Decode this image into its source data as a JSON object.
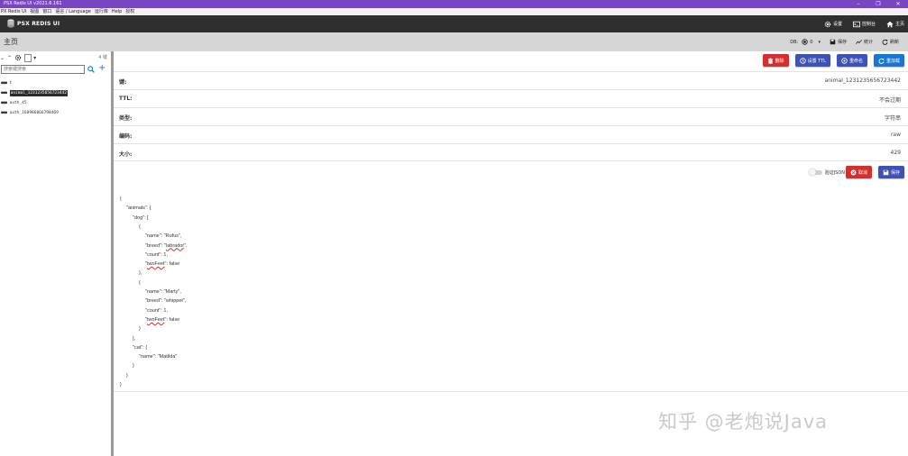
{
  "window": {
    "title": "PSX Redis UI v2021.6.161",
    "controls": [
      "–",
      "❐",
      "✕"
    ]
  },
  "menu": [
    "PX Redis UI",
    "视图",
    "窗口",
    "语言 / Language",
    "运行库",
    "Help",
    "授权"
  ],
  "appbar": {
    "brand": "PSX REDIS UI",
    "nav": [
      {
        "label": "设置",
        "icon": "gear-icon"
      },
      {
        "label": "控制台",
        "icon": "console-icon"
      },
      {
        "label": "主页",
        "icon": "home-icon"
      }
    ]
  },
  "page": {
    "title": "主页",
    "db_label": "DB:",
    "db_value": "0",
    "db_caret": "▾",
    "save_label": "保存",
    "stats_label": "统计",
    "refresh_label": "刷新"
  },
  "sidebar": {
    "tools": [
      "⌄",
      "⌃"
    ],
    "count": "4 键",
    "search_placeholder": "搜索键搜索",
    "plus": "+",
    "dots": "●●●",
    "keys": [
      {
        "name": "t",
        "active": false
      },
      {
        "name": "animal_1231235656723442",
        "active": true
      },
      {
        "name": "auth_45",
        "active": false
      },
      {
        "name": "auth_168986866798469",
        "active": false
      }
    ]
  },
  "key_actions": {
    "delete": "删除",
    "ttl": "设置 TTL",
    "rename": "重命名",
    "reload": "重加载"
  },
  "details": [
    {
      "label": "键:",
      "value": "animal_1231235656723442"
    },
    {
      "label": "TTL:",
      "value": "不会过期"
    },
    {
      "label": "类型:",
      "value": "字符串"
    },
    {
      "label": "编码:",
      "value": "raw"
    },
    {
      "label": "大小:",
      "value": "429"
    }
  ],
  "editor_bar": {
    "validate_json": "验证JSON",
    "cancel": "取消",
    "save": "保存"
  },
  "json_lines": [
    {
      "indent": 0,
      "text": "{"
    },
    {
      "indent": 1,
      "text": "\"animals\": {"
    },
    {
      "indent": 2,
      "text": "\"dog\": ["
    },
    {
      "indent": 3,
      "text": "{"
    },
    {
      "indent": 4,
      "text": "\"name\": \"Rufus\","
    },
    {
      "indent": 4,
      "text": "\"breed\": \"labrador\","
    },
    {
      "indent": 4,
      "text": "\"count\": 1,"
    },
    {
      "indent": 4,
      "text": "\"twoFeet\": false"
    },
    {
      "indent": 3,
      "text": "},"
    },
    {
      "indent": 3,
      "text": "{"
    },
    {
      "indent": 4,
      "text": "\"name\": \"Marty\","
    },
    {
      "indent": 4,
      "text": "\"breed\": \"whippet\","
    },
    {
      "indent": 4,
      "text": "\"count\": 1,"
    },
    {
      "indent": 4,
      "text": "\"twoFeet\": false"
    },
    {
      "indent": 3,
      "text": "}"
    },
    {
      "indent": 2,
      "text": "],"
    },
    {
      "indent": 2,
      "text": "\"cat\": {"
    },
    {
      "indent": 3,
      "text": "\"name\": \"Matilda\""
    },
    {
      "indent": 2,
      "text": "}"
    },
    {
      "indent": 1,
      "text": "}"
    },
    {
      "indent": 0,
      "text": "}"
    }
  ],
  "watermark": "知乎 @老炮说Java",
  "colors": {
    "titlebar": "#7a45c2",
    "appbar": "#2f2f2f",
    "danger": "#d32f2f",
    "indigo": "#3f51b5",
    "primary": "#1976d2"
  }
}
